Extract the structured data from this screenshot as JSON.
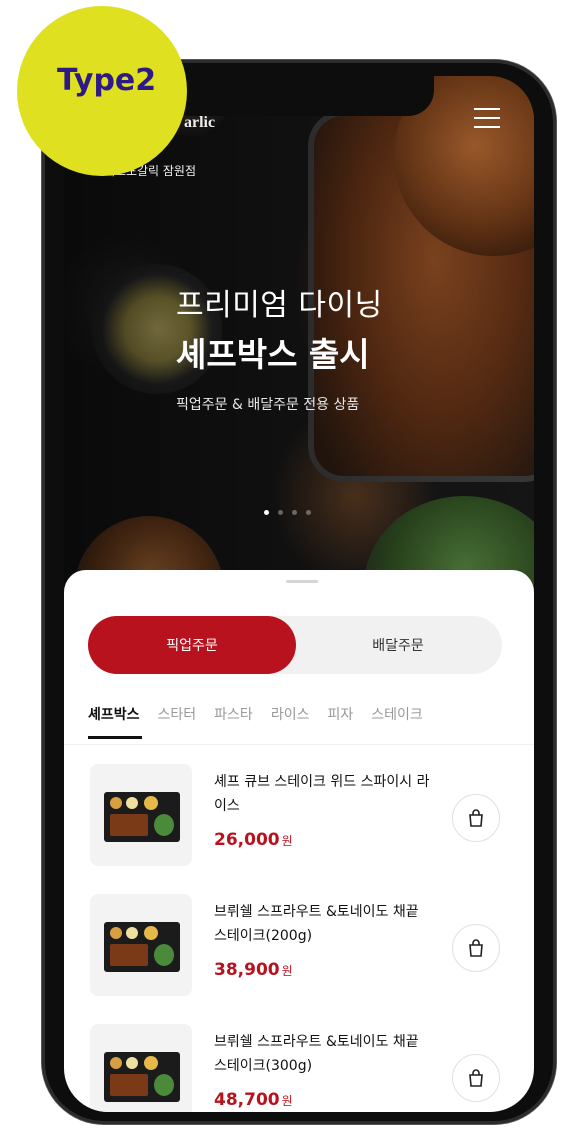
{
  "badge": {
    "label": "Type2"
  },
  "header": {
    "brand": "arlic",
    "store": "세프포갈릭 잠원점"
  },
  "hero": {
    "line1": "프리미엄 다이닝",
    "line2": "셰프박스 출시",
    "sub": "픽업주문 & 배달주문 전용 상품",
    "slides": 4,
    "active_slide": 1
  },
  "order_toggle": {
    "pickup": "픽업주문",
    "delivery": "배달주문",
    "selected": "pickup"
  },
  "categories": [
    "셰프박스",
    "스타터",
    "파스타",
    "라이스",
    "피자",
    "스테이크"
  ],
  "items": [
    {
      "name": "셰프 큐브 스테이크 위드 스파이시 라이스",
      "price": "26,000",
      "unit": "원"
    },
    {
      "name": "브뤼쉘 스프라우트 &토네이도 채끝 스테이크(200g)",
      "price": "38,900",
      "unit": "원"
    },
    {
      "name": "브뤼쉘 스프라우트 &토네이도 채끝 스테이크(300g)",
      "price": "48,700",
      "unit": "원"
    }
  ],
  "colors": {
    "accent": "#b8121e",
    "badge": "#dfe020",
    "badge_text": "#2d1a87"
  }
}
